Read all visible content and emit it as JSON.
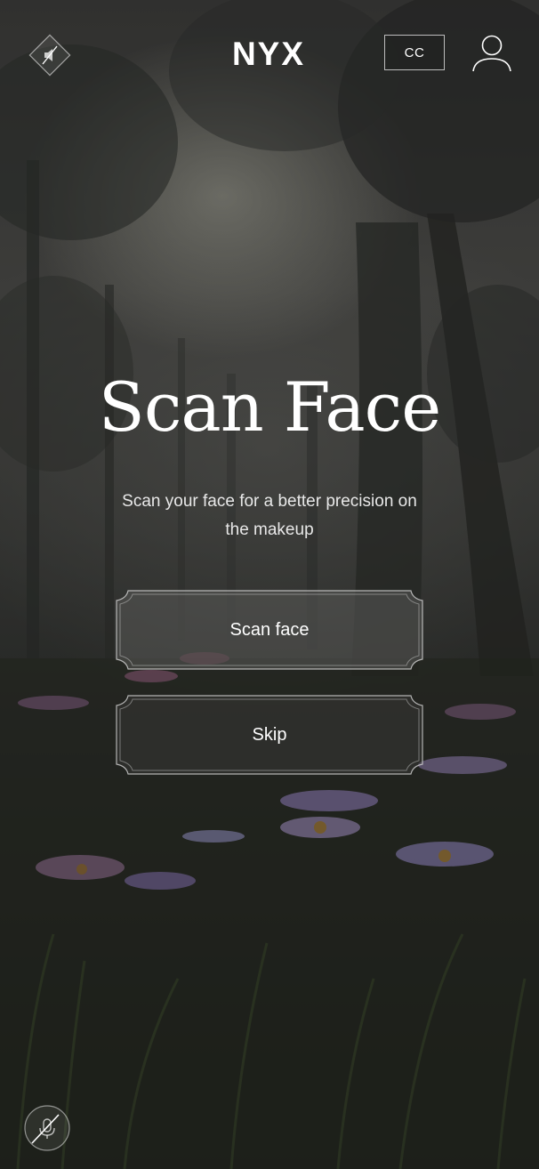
{
  "header": {
    "sound_icon": "sound-muted-icon",
    "brand": "NYX",
    "cc_label": "CC",
    "profile_icon": "user-profile-icon"
  },
  "main": {
    "title": "Scan Face",
    "subtitle": "Scan your face for a better precision on the makeup",
    "buttons": {
      "scan_label": "Scan face",
      "skip_label": "Skip"
    }
  },
  "footer": {
    "mic_icon": "microphone-muted-icon"
  },
  "colors": {
    "text": "#ffffff",
    "button_fill": "#5a5a58",
    "button_border": "#cfcfcf"
  }
}
